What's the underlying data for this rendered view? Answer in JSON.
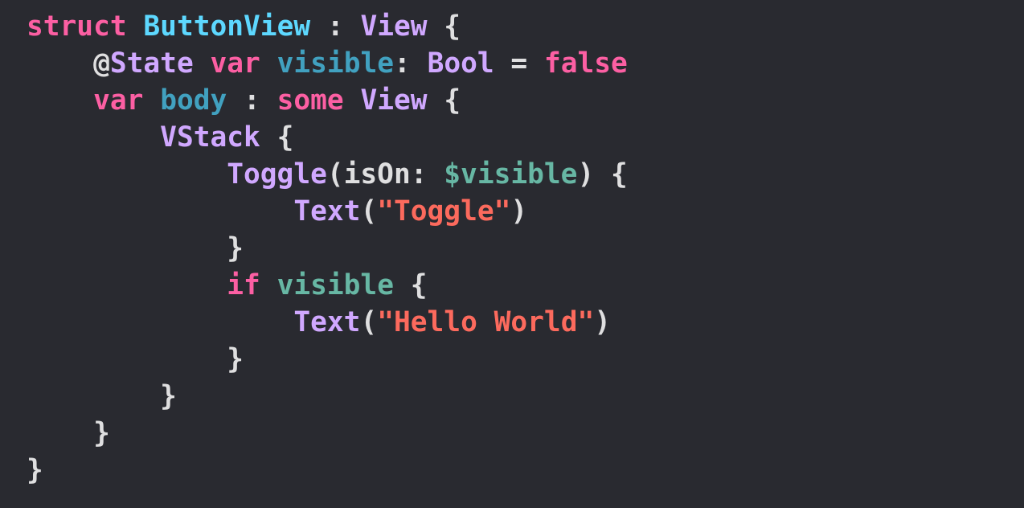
{
  "colors": {
    "background": "#292a30",
    "keyword": "#fc5fa3",
    "type": "#d0a8ff",
    "declaration": "#5dd8ff",
    "variable": "#67b7a4",
    "property": "#41a1c0",
    "string": "#fc6a5d",
    "plain": "#dfdfe0"
  },
  "lines": [
    {
      "indent": "",
      "tokens": [
        {
          "text": "struct",
          "kind": "keyword"
        },
        {
          "text": " ",
          "kind": "plain"
        },
        {
          "text": "ButtonView",
          "kind": "declaration"
        },
        {
          "text": " : ",
          "kind": "plain"
        },
        {
          "text": "View",
          "kind": "type"
        },
        {
          "text": " {",
          "kind": "plain"
        }
      ]
    },
    {
      "indent": "    ",
      "tokens": [
        {
          "text": "@",
          "kind": "plain"
        },
        {
          "text": "State",
          "kind": "type"
        },
        {
          "text": " ",
          "kind": "plain"
        },
        {
          "text": "var",
          "kind": "keyword"
        },
        {
          "text": " ",
          "kind": "plain"
        },
        {
          "text": "visible",
          "kind": "property"
        },
        {
          "text": ": ",
          "kind": "plain"
        },
        {
          "text": "Bool",
          "kind": "type"
        },
        {
          "text": " = ",
          "kind": "plain"
        },
        {
          "text": "false",
          "kind": "keyword"
        }
      ]
    },
    {
      "indent": "    ",
      "tokens": [
        {
          "text": "var",
          "kind": "keyword"
        },
        {
          "text": " ",
          "kind": "plain"
        },
        {
          "text": "body",
          "kind": "property"
        },
        {
          "text": " : ",
          "kind": "plain"
        },
        {
          "text": "some",
          "kind": "keyword"
        },
        {
          "text": " ",
          "kind": "plain"
        },
        {
          "text": "View",
          "kind": "type"
        },
        {
          "text": " {",
          "kind": "plain"
        }
      ]
    },
    {
      "indent": "        ",
      "tokens": [
        {
          "text": "VStack",
          "kind": "type"
        },
        {
          "text": " {",
          "kind": "plain"
        }
      ]
    },
    {
      "indent": "            ",
      "tokens": [
        {
          "text": "Toggle",
          "kind": "type"
        },
        {
          "text": "(isOn: ",
          "kind": "plain"
        },
        {
          "text": "$visible",
          "kind": "variable"
        },
        {
          "text": ") {",
          "kind": "plain"
        }
      ]
    },
    {
      "indent": "                ",
      "tokens": [
        {
          "text": "Text",
          "kind": "type"
        },
        {
          "text": "(",
          "kind": "plain"
        },
        {
          "text": "\"Toggle\"",
          "kind": "string"
        },
        {
          "text": ")",
          "kind": "plain"
        }
      ]
    },
    {
      "indent": "            ",
      "tokens": [
        {
          "text": "}",
          "kind": "plain"
        }
      ]
    },
    {
      "indent": "            ",
      "tokens": [
        {
          "text": "if",
          "kind": "keyword"
        },
        {
          "text": " ",
          "kind": "plain"
        },
        {
          "text": "visible",
          "kind": "variable"
        },
        {
          "text": " {",
          "kind": "plain"
        }
      ]
    },
    {
      "indent": "                ",
      "tokens": [
        {
          "text": "Text",
          "kind": "type"
        },
        {
          "text": "(",
          "kind": "plain"
        },
        {
          "text": "\"Hello World\"",
          "kind": "string"
        },
        {
          "text": ")",
          "kind": "plain"
        }
      ]
    },
    {
      "indent": "            ",
      "tokens": [
        {
          "text": "}",
          "kind": "plain"
        }
      ]
    },
    {
      "indent": "        ",
      "tokens": [
        {
          "text": "}",
          "kind": "plain"
        }
      ]
    },
    {
      "indent": "    ",
      "tokens": [
        {
          "text": "}",
          "kind": "plain"
        }
      ]
    },
    {
      "indent": "",
      "tokens": [
        {
          "text": "}",
          "kind": "plain"
        }
      ]
    }
  ]
}
